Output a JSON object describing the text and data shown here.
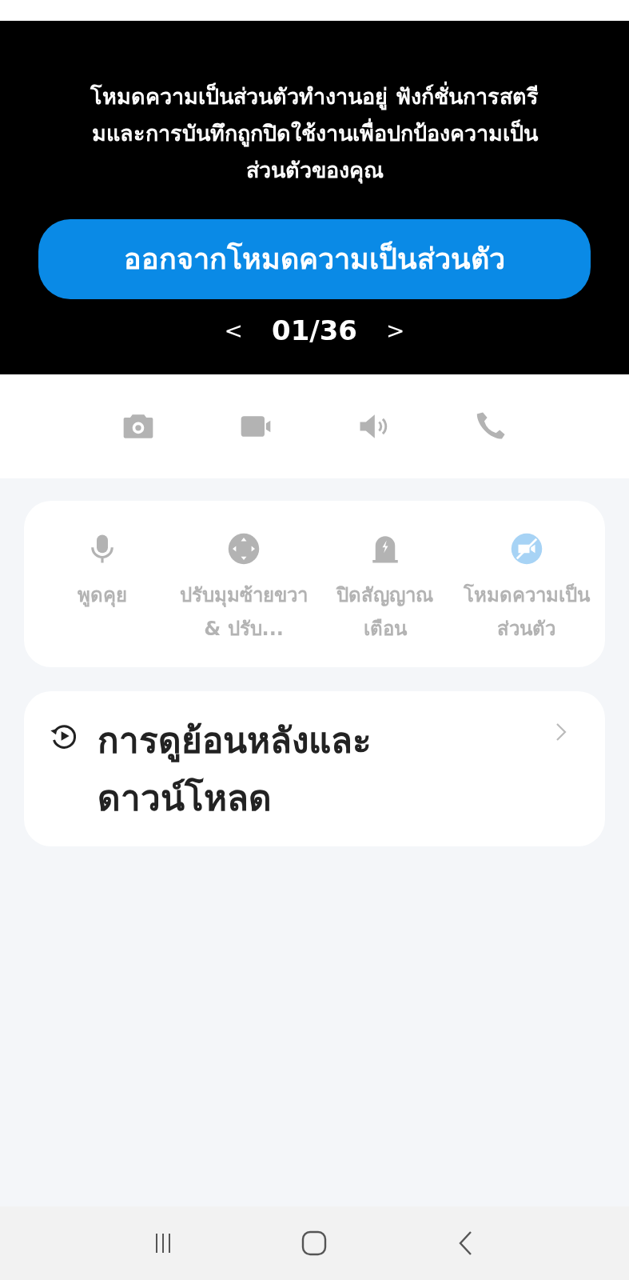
{
  "banner": {
    "message": "โหมดความเป็นส่วนตัวทำงานอยู่ ฟังก์ชั่นการสตรีมและการบันทึกถูกปิดใช้งานเพื่อปกป้องความเป็นส่วนตัวของคุณ",
    "button": "ออกจากโหมดความเป็นส่วนตัว",
    "pager": {
      "prev": "<",
      "position": "01/36",
      "next": ">"
    }
  },
  "toolbar": [
    {
      "kind": "camera"
    },
    {
      "kind": "video"
    },
    {
      "kind": "speaker"
    },
    {
      "kind": "phone"
    }
  ],
  "features": [
    {
      "kind": "mic",
      "label": "พูดคุย",
      "active": false
    },
    {
      "kind": "pan",
      "label": "ปรับมุมซ้ายขวา & ปรับ...",
      "active": false
    },
    {
      "kind": "alarm",
      "label": "ปิดสัญญาณเตือน",
      "active": false
    },
    {
      "kind": "privacy",
      "label": "โหมดความเป็นส่วนตัว",
      "active": true
    }
  ],
  "playback": {
    "title": "การดูย้อนหลังและดาวน์โหลด"
  }
}
